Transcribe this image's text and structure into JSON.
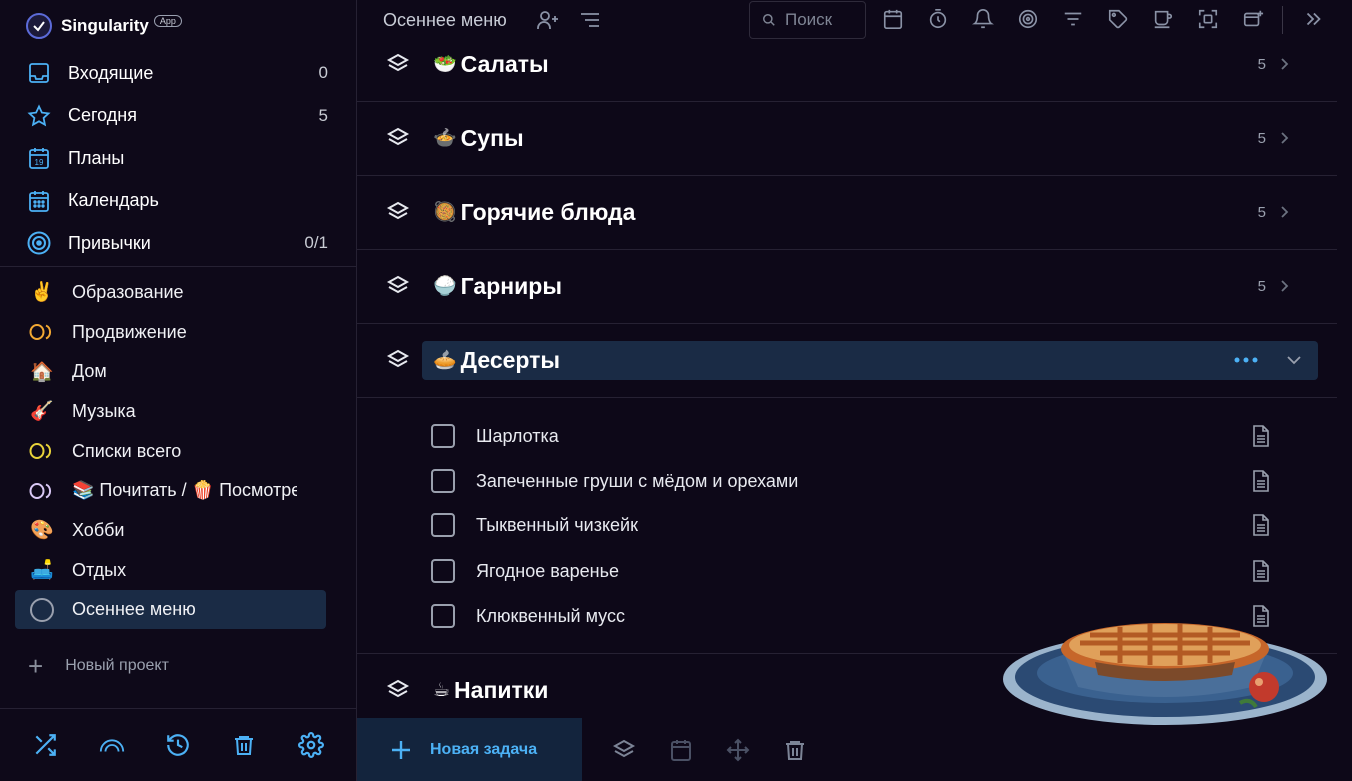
{
  "app": {
    "name": "Singularity",
    "badge": "App"
  },
  "nav": [
    {
      "label": "Входящие",
      "count": "0",
      "icon": "inbox-icon"
    },
    {
      "label": "Сегодня",
      "count": "5",
      "icon": "star-icon"
    },
    {
      "label": "Планы",
      "count": "",
      "icon": "calendar-19-icon"
    },
    {
      "label": "Календарь",
      "count": "",
      "icon": "calendar-grid-icon"
    },
    {
      "label": "Привычки",
      "count": "0/1",
      "icon": "target-icon"
    }
  ],
  "projects": [
    {
      "label": "Образование",
      "emoji": "✌️",
      "color": "#f2d333"
    },
    {
      "label": "Продвижение",
      "emoji": "",
      "color": "#f2a833"
    },
    {
      "label": "Дом",
      "emoji": "🏠",
      "color": "#4ecb4e"
    },
    {
      "label": "Музыка",
      "emoji": "🎸",
      "color": "#d94343"
    },
    {
      "label": "Списки всего",
      "emoji": "",
      "color": "#e8d23a"
    },
    {
      "label": "📚 Почитать / 🍿 Посмотреть",
      "emoji": "",
      "color": "#c9b4f0"
    },
    {
      "label": "Хобби",
      "emoji": "🎨",
      "color": "#f2d333"
    },
    {
      "label": "Отдых",
      "emoji": "🛋️",
      "color": "#4ecb4e"
    },
    {
      "label": "Осеннее меню",
      "emoji": "",
      "color": "#9aa0ae"
    }
  ],
  "new_project": "Новый проект",
  "topbar": {
    "title": "Осеннее меню",
    "search_placeholder": "Поиск"
  },
  "sections": [
    {
      "emoji": "🥗",
      "title": "Салаты",
      "count": "5"
    },
    {
      "emoji": "🍲",
      "title": "Супы",
      "count": "5"
    },
    {
      "emoji": "🥘",
      "title": "Горячие блюда",
      "count": "5"
    },
    {
      "emoji": "🍚",
      "title": "Гарниры",
      "count": "5"
    },
    {
      "emoji": "🥧",
      "title": "Десерты",
      "count": ""
    },
    {
      "emoji": "☕",
      "title": "Напитки",
      "count": ""
    }
  ],
  "tasks": [
    "Шарлотка",
    "Запеченные груши с мёдом и орехами",
    "Тыквенный чизкейк",
    "Ягодное варенье",
    "Клюквенный мусс"
  ],
  "bottom": {
    "new_task": "Новая задача"
  },
  "colors": {
    "accent": "#4cb1f5",
    "active_bg": "#1a2b45",
    "bg": "#0d0818"
  }
}
